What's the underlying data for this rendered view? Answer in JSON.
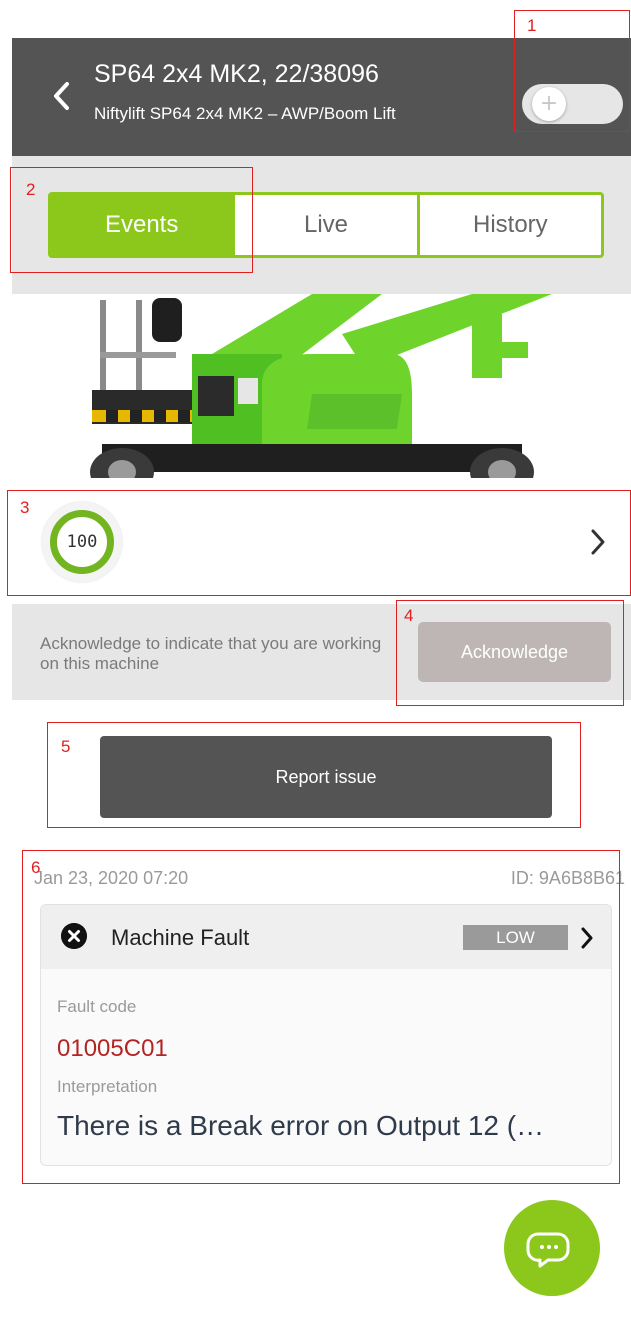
{
  "header": {
    "title": "SP64 2x4 MK2, 22/38096",
    "subtitle": "Niftylift SP64 2x4 MK2 – AWP/Boom Lift",
    "toggle_symbol": "+"
  },
  "tabs": [
    {
      "label": "Events",
      "active": true
    },
    {
      "label": "Live",
      "active": false
    },
    {
      "label": "History",
      "active": false
    }
  ],
  "health": {
    "score": "100"
  },
  "acknowledge": {
    "text": "Acknowledge to indicate that you are working on this machine",
    "button_label": "Acknowledge"
  },
  "report": {
    "button_label": "Report issue"
  },
  "event": {
    "date": "Jan 23, 2020 07:20",
    "id": "ID: 9A6B8B61",
    "title": "Machine Fault",
    "level": "LOW",
    "fault_code_label": "Fault code",
    "fault_code": "01005C01",
    "interpretation_label": "Interpretation",
    "interpretation": "There is a Break error on Output 12 (…"
  },
  "annotations": [
    "1",
    "2",
    "3",
    "4",
    "5",
    "6"
  ],
  "colors": {
    "header": "#545454",
    "accent_green": "#8cc71c",
    "fault_red": "#b22525",
    "annotation_red": "#e02020"
  },
  "icons": {
    "back": "chevron-left-icon",
    "chevron": "chevron-right-icon",
    "fault": "close-circle-icon",
    "chat": "chat-bubble-icon"
  }
}
